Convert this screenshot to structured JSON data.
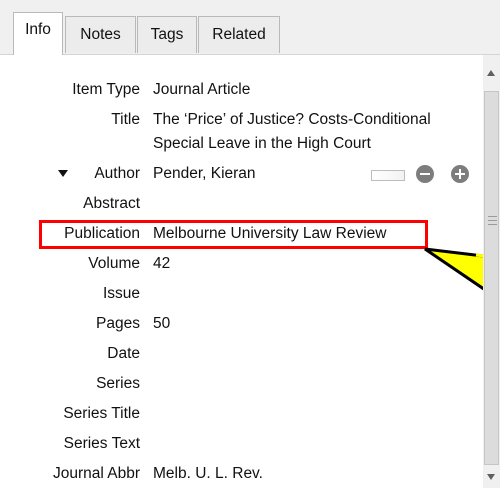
{
  "tabs": [
    "Info",
    "Notes",
    "Tags",
    "Related"
  ],
  "fields": {
    "item_type": {
      "label": "Item Type",
      "value": "Journal Article"
    },
    "title": {
      "label": "Title",
      "value_line1": "The ‘Price’ of Justice? Costs-Conditional",
      "value_line2": "Special Leave in the High Court"
    },
    "author": {
      "label": "Author",
      "value": "Pender, Kieran"
    },
    "abstract": {
      "label": "Abstract",
      "value": ""
    },
    "publication": {
      "label": "Publication",
      "value": "Melbourne University Law Review"
    },
    "volume": {
      "label": "Volume",
      "value": "42"
    },
    "issue": {
      "label": "Issue",
      "value": ""
    },
    "pages": {
      "label": "Pages",
      "value": "50"
    },
    "date": {
      "label": "Date",
      "value": ""
    },
    "series": {
      "label": "Series",
      "value": ""
    },
    "series_title": {
      "label": "Series Title",
      "value": ""
    },
    "series_text": {
      "label": "Series Text",
      "value": ""
    },
    "journal_abbr": {
      "label": "Journal Abbr",
      "value": "Melb. U. L. Rev."
    }
  },
  "icons": {
    "expand": "triangle-down-icon",
    "remove": "minus-circle-icon",
    "add": "plus-circle-icon"
  },
  "colors": {
    "highlight": "#ff0000",
    "callout": "#ffff00"
  }
}
